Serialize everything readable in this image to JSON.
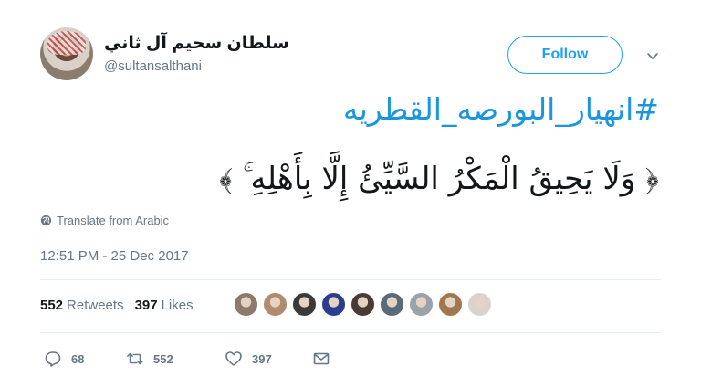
{
  "user": {
    "display_name": "سلطان سحيم آل ثاني",
    "handle": "@sultansalthani"
  },
  "follow_label": "Follow",
  "tweet": {
    "hashtag": "#انهيار_البورصه_القطريه",
    "text": "﴿ وَلَا يَحِيقُ الْمَكْرُ السَّيِّئُ إِلَّا بِأَهْلِهِ ۚ ﴾",
    "translate_label": "Translate from Arabic",
    "timestamp": "12:51 PM - 25 Dec 2017"
  },
  "stats": {
    "retweets_count": "552",
    "retweets_label": "Retweets",
    "likes_count": "397",
    "likes_label": "Likes"
  },
  "liker_avatar_colors": [
    "#8c7a6b",
    "#b08b6e",
    "#3a3a3a",
    "#2a3d8f",
    "#4a3b36",
    "#5a6a7a",
    "#9aa3ab",
    "#a0784f",
    "#d9d3cc"
  ],
  "actions": {
    "reply_count": "68",
    "retweet_count": "552",
    "like_count": "397"
  },
  "icons": {
    "caret": "chevron-down-icon",
    "globe": "globe-icon",
    "reply": "reply-icon",
    "retweet": "retweet-icon",
    "like": "heart-icon",
    "message": "envelope-icon"
  }
}
